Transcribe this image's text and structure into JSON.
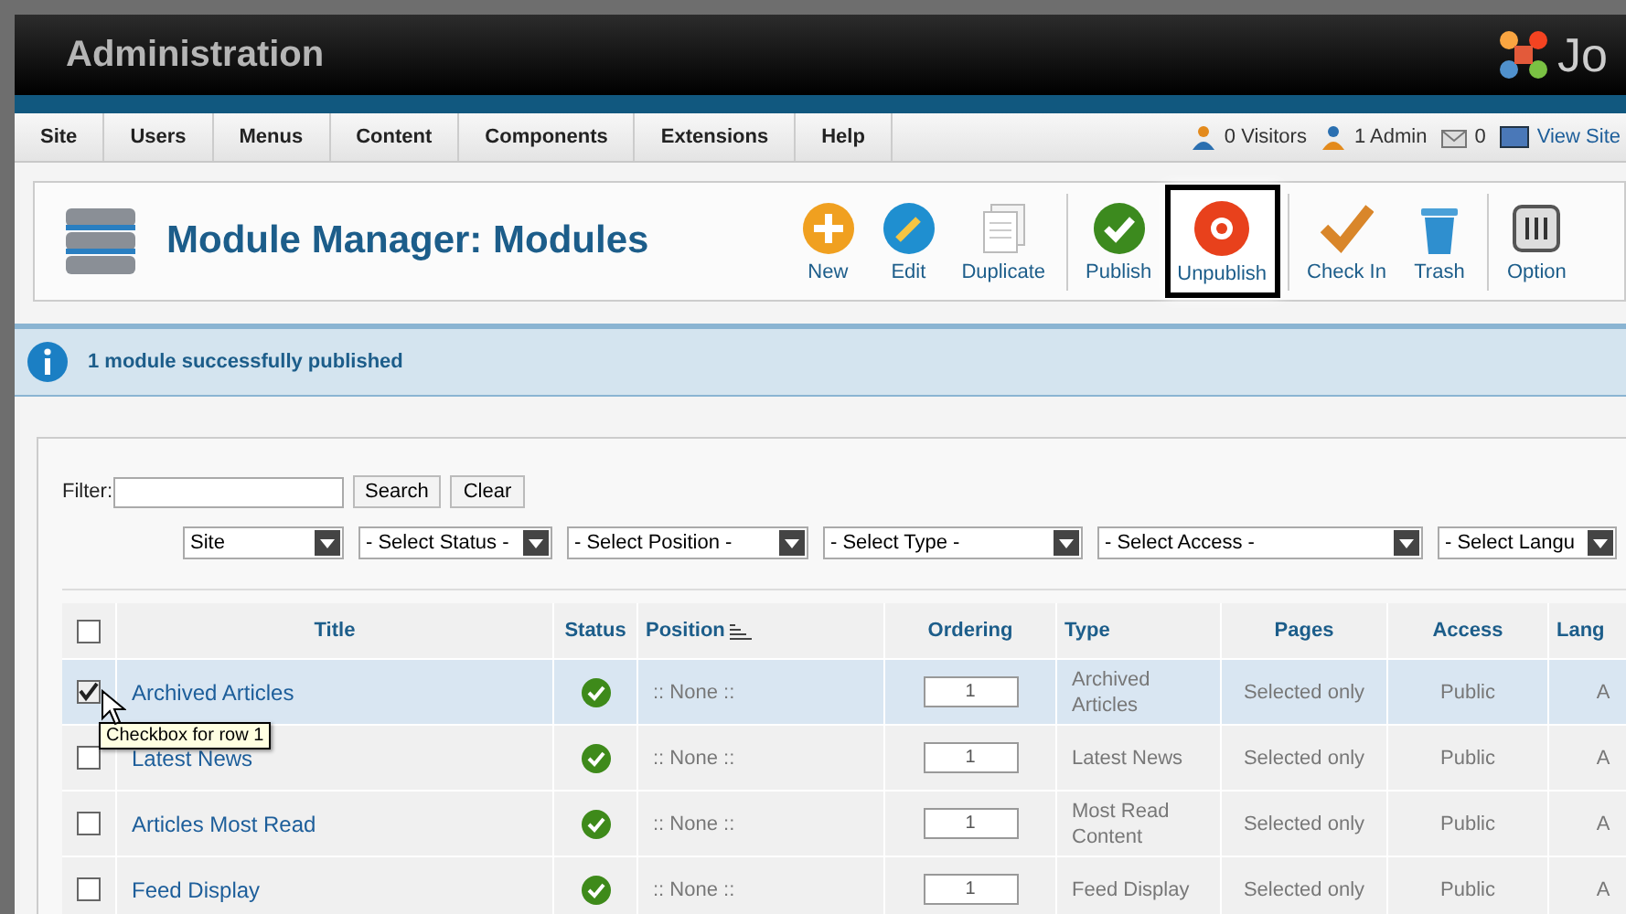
{
  "header": {
    "title": "Administration",
    "logo_text": "Jo"
  },
  "menu": [
    "Site",
    "Users",
    "Menus",
    "Content",
    "Components",
    "Extensions",
    "Help"
  ],
  "status": [
    {
      "kind": "visitors",
      "text": "0 Visitors"
    },
    {
      "kind": "admin",
      "text": "1 Admin"
    },
    {
      "kind": "mail",
      "text": "0"
    },
    {
      "kind": "site",
      "text": "View Site"
    }
  ],
  "toolbar": {
    "title": "Module Manager: Modules",
    "buttons": [
      {
        "kind": "new",
        "label": "New",
        "highlighted": false,
        "separator_before": false
      },
      {
        "kind": "edit",
        "label": "Edit",
        "highlighted": false,
        "separator_before": false
      },
      {
        "kind": "duplicate",
        "label": "Duplicate",
        "highlighted": false,
        "separator_before": false
      },
      {
        "kind": "publish",
        "label": "Publish",
        "highlighted": false,
        "separator_before": true
      },
      {
        "kind": "unpublish",
        "label": "Unpublish",
        "highlighted": true,
        "separator_before": false
      },
      {
        "kind": "checkin",
        "label": "Check In",
        "highlighted": false,
        "separator_before": true
      },
      {
        "kind": "trash",
        "label": "Trash",
        "highlighted": false,
        "separator_before": false
      },
      {
        "kind": "options",
        "label": "Option",
        "highlighted": false,
        "separator_before": true
      }
    ]
  },
  "message": "1 module successfully published",
  "filter": {
    "label": "Filter:",
    "buttons": [
      "Search",
      "Clear"
    ],
    "selects": [
      "Site",
      "- Select Status -",
      "- Select Position -",
      "- Select Type -",
      "- Select Access -",
      "- Select Langu"
    ]
  },
  "table": {
    "all_checked": false,
    "columns": [
      "Title",
      "Status",
      "Position",
      "Ordering",
      "Type",
      "Pages",
      "Access",
      "Lang"
    ],
    "rows": [
      {
        "checked": true,
        "hovered": true,
        "title": "Archived Articles",
        "published": true,
        "position": ":: None ::",
        "ordering": "1",
        "type": "Archived Articles",
        "pages": "Selected only",
        "access": "Public",
        "lang": "A"
      },
      {
        "checked": false,
        "hovered": false,
        "title": "Latest News",
        "published": true,
        "position": ":: None ::",
        "ordering": "1",
        "type": "Latest News",
        "pages": "Selected only",
        "access": "Public",
        "lang": "A"
      },
      {
        "checked": false,
        "hovered": false,
        "title": "Articles Most Read",
        "published": true,
        "position": ":: None ::",
        "ordering": "1",
        "type": "Most Read Content",
        "pages": "Selected only",
        "access": "Public",
        "lang": "A"
      },
      {
        "checked": false,
        "hovered": false,
        "title": "Feed Display",
        "published": true,
        "position": ":: None ::",
        "ordering": "1",
        "type": "Feed Display",
        "pages": "Selected only",
        "access": "Public",
        "lang": "A"
      }
    ]
  },
  "tooltip": "Checkbox for row 1"
}
